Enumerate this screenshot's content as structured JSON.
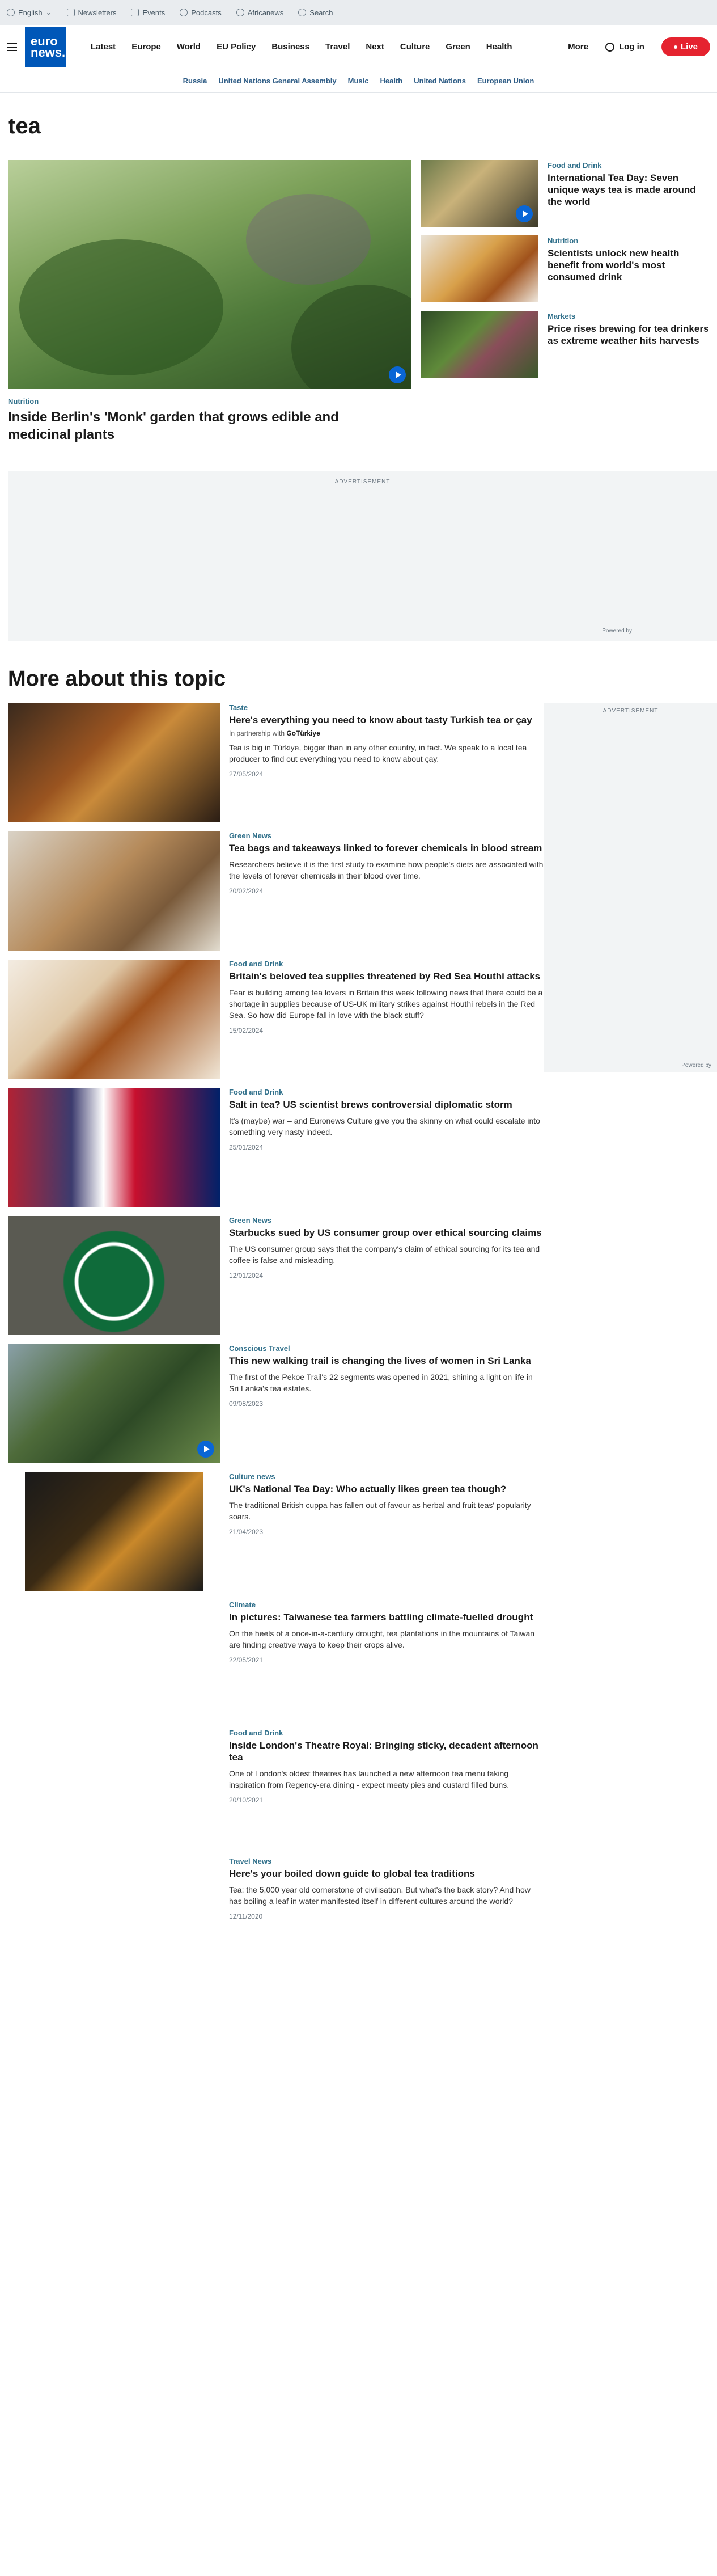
{
  "utility": {
    "language": "English",
    "newsletters": "Newsletters",
    "events": "Events",
    "podcasts": "Podcasts",
    "africanews": "Africanews",
    "search": "Search"
  },
  "nav": {
    "logo_line1": "euro",
    "logo_line2": "news.",
    "links": [
      "Latest",
      "Europe",
      "World",
      "EU Policy",
      "Business",
      "Travel",
      "Next",
      "Culture",
      "Green",
      "Health"
    ],
    "more": "More",
    "login": "Log in",
    "live": "Live"
  },
  "subnav": [
    "Russia",
    "United Nations General Assembly",
    "Music",
    "Health",
    "United Nations",
    "European Union"
  ],
  "page_title": "tea",
  "hero": {
    "kicker": "Nutrition",
    "title": "Inside Berlin's 'Monk' garden that grows edible and medicinal plants"
  },
  "side": [
    {
      "kicker": "Food and Drink",
      "title": "International Tea Day: Seven unique ways tea is made around the world"
    },
    {
      "kicker": "Nutrition",
      "title": "Scientists unlock new health benefit from world's most consumed drink"
    },
    {
      "kicker": "Markets",
      "title": "Price rises brewing for tea drinkers as extreme weather hits harvests"
    }
  ],
  "ad": {
    "label": "ADVERTISEMENT",
    "powered": "Powered by"
  },
  "more_title": "More about this topic",
  "articles": [
    {
      "kicker": "Taste",
      "title": "Here's everything you need to know about tasty Turkish tea or çay",
      "partner_prefix": "In partnership with",
      "partner": "GoTürkiye",
      "desc": "Tea is big in Türkiye, bigger than in any other country, in fact. We speak to a local tea producer to find out everything you need to know about çay.",
      "date": "27/05/2024"
    },
    {
      "kicker": "Green News",
      "title": "Tea bags and takeaways linked to forever chemicals in blood stream",
      "desc": "Researchers believe it is the first study to examine how people's diets are associated with the levels of forever chemicals in their blood over time.",
      "date": "20/02/2024"
    },
    {
      "kicker": "Food and Drink",
      "title": "Britain's beloved tea supplies threatened by Red Sea Houthi attacks",
      "desc": "Fear is building among tea lovers in Britain this week following news that there could be a shortage in supplies because of US-UK military strikes against Houthi rebels in the Red Sea. So how did Europe fall in love with the black stuff?",
      "date": "15/02/2024"
    },
    {
      "kicker": "Food and Drink",
      "title": "Salt in tea? US scientist brews controversial diplomatic storm",
      "desc": "It's (maybe) war – and Euronews Culture give you the skinny on what could escalate into something very nasty indeed.",
      "date": "25/01/2024"
    },
    {
      "kicker": "Green News",
      "title": "Starbucks sued by US consumer group over ethical sourcing claims",
      "desc": "The US consumer group says that the company's claim of ethical sourcing for its tea and coffee is false and misleading.",
      "date": "12/01/2024"
    },
    {
      "kicker": "Conscious Travel",
      "title": "This new walking trail is changing the lives of women in Sri Lanka",
      "desc": "The first of the Pekoe Trail's 22 segments was opened in 2021, shining a light on life in Sri Lanka's tea estates.",
      "date": "09/08/2023"
    },
    {
      "kicker": "Culture news",
      "title": "UK's National Tea Day: Who actually likes green tea though?",
      "desc": "The traditional British cuppa has fallen out of favour as herbal and fruit teas' popularity soars.",
      "date": "21/04/2023"
    },
    {
      "kicker": "Climate",
      "title": "In pictures: Taiwanese tea farmers battling climate-fuelled drought",
      "desc": "On the heels of a once-in-a-century drought, tea plantations in the mountains of Taiwan are finding creative ways to keep their crops alive.",
      "date": "22/05/2021"
    },
    {
      "kicker": "Food and Drink",
      "title": "Inside London's Theatre Royal: Bringing sticky, decadent afternoon tea",
      "desc": "One of London's oldest theatres has launched a new afternoon tea menu taking inspiration from Regency-era dining - expect meaty pies and custard filled buns.",
      "date": "20/10/2021"
    },
    {
      "kicker": "Travel News",
      "title": "Here's your boiled down guide to global tea traditions",
      "desc": "Tea: the 5,000 year old cornerstone of civilisation. But what's the back story? And how has boiling a leaf in water manifested itself in different cultures around the world?",
      "date": "12/11/2020"
    }
  ],
  "colors": {
    "brand": "#0057b8",
    "live": "#e5232f",
    "kicker": "#2f6f8a",
    "play": "#0a66d6"
  }
}
